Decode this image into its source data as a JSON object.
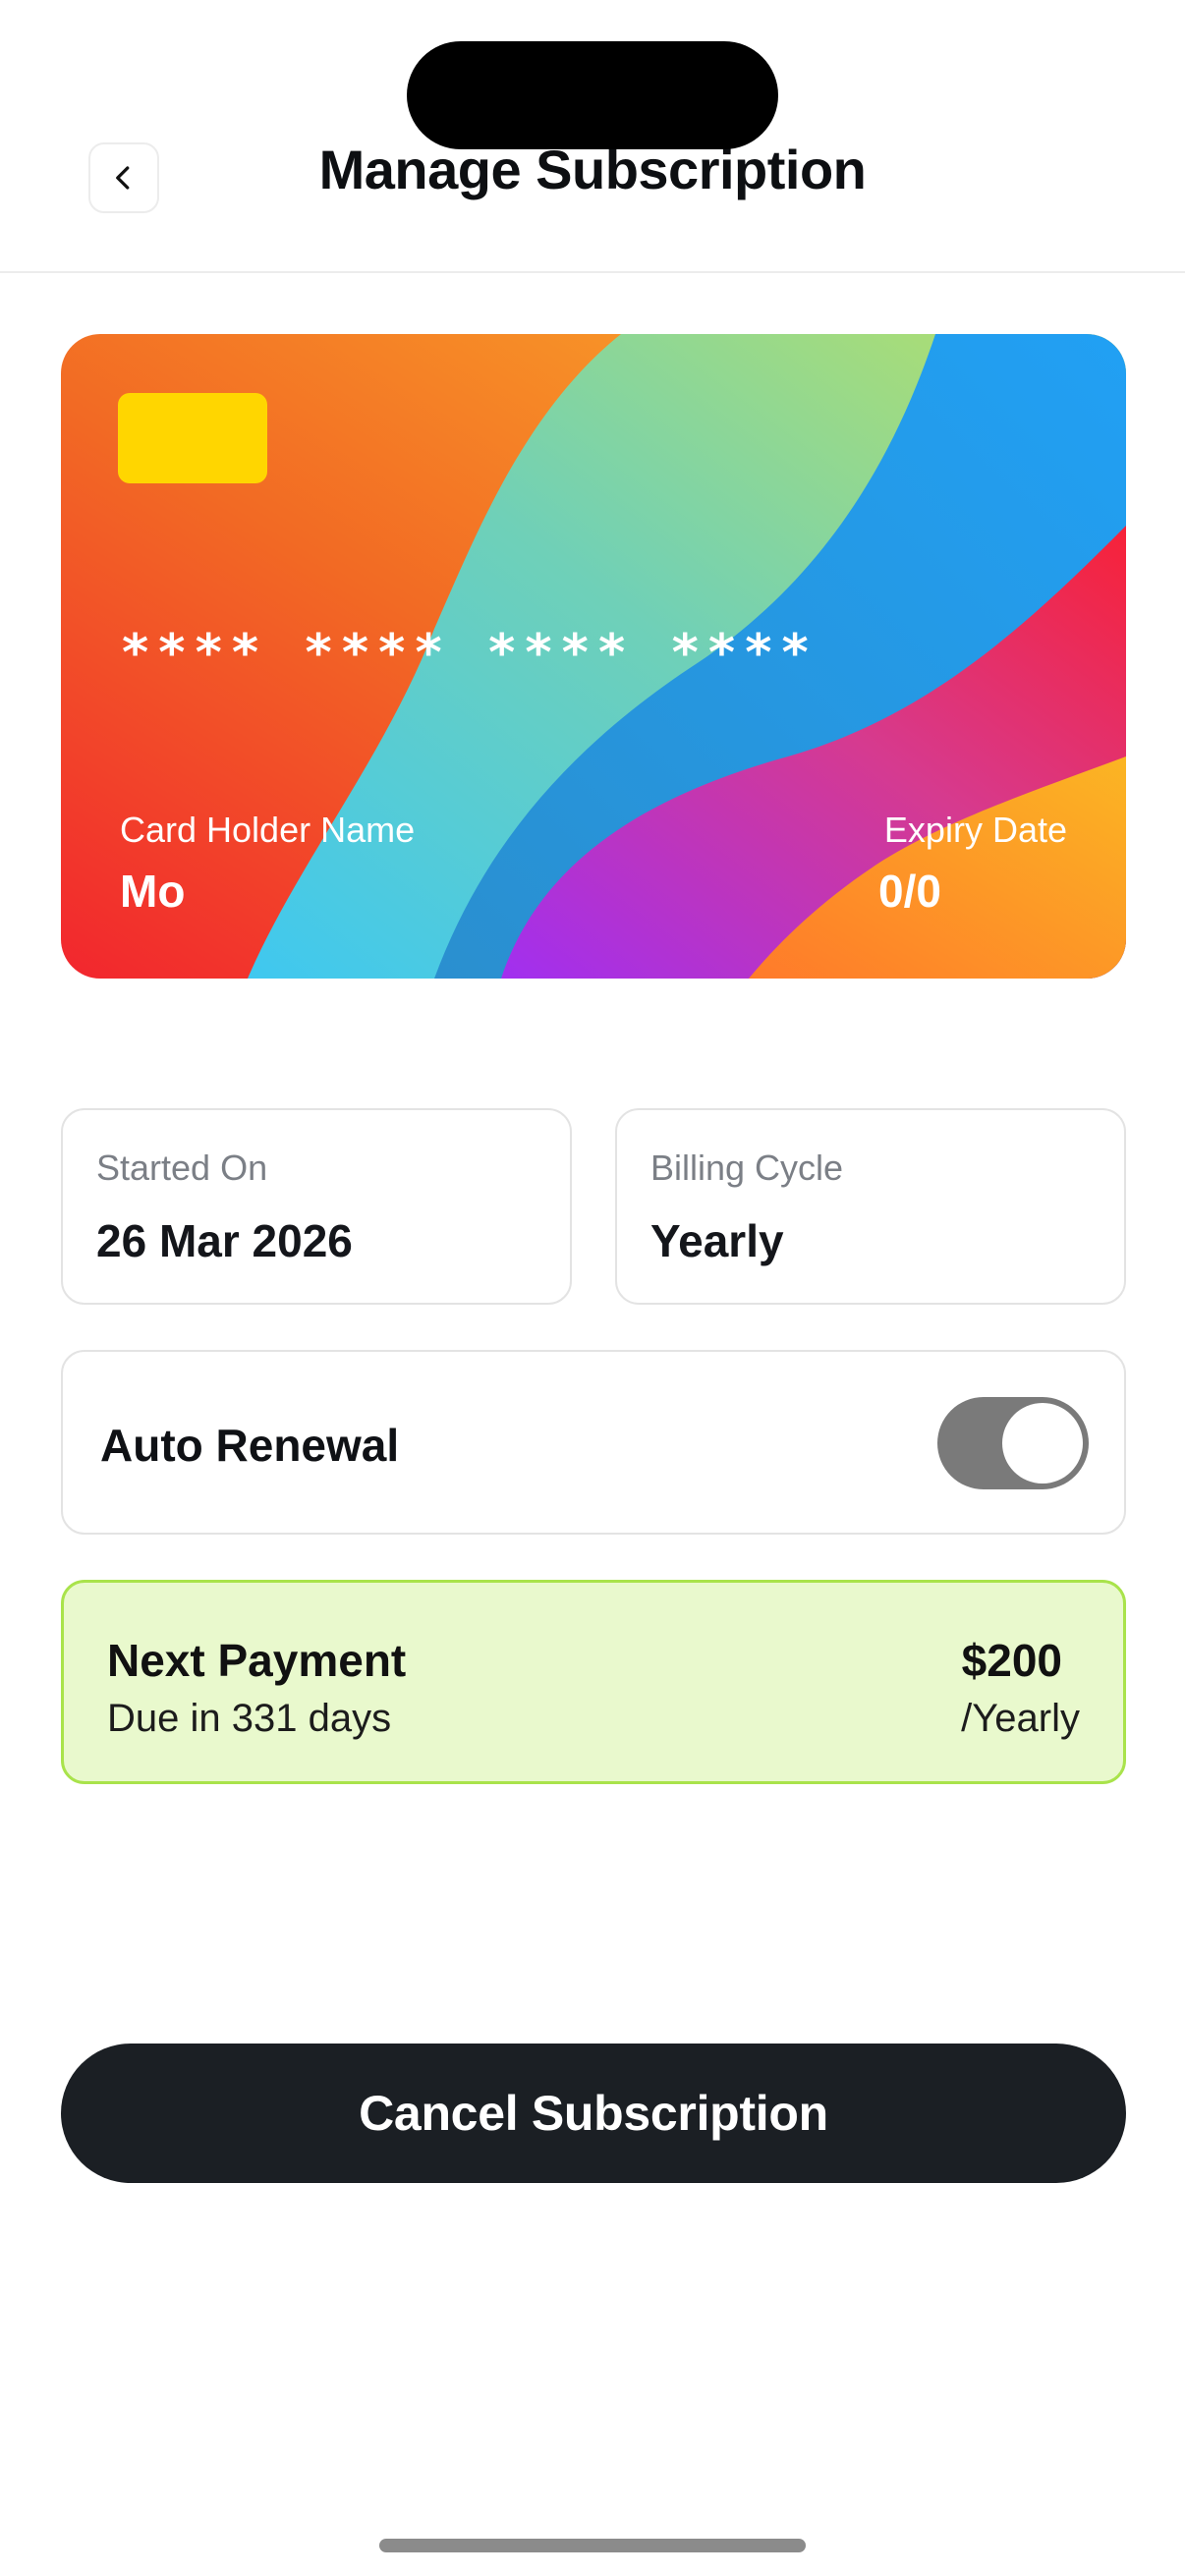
{
  "header": {
    "title": "Manage Subscription",
    "back_icon": "chevron-left-icon"
  },
  "card": {
    "number_masked": "**** **** **** ****",
    "holder_label": "Card Holder Name",
    "holder_value": "Mo",
    "expiry_label": "Expiry Date",
    "expiry_value": "0/0",
    "chip_color": "#FFD600"
  },
  "details": {
    "started_label": "Started On",
    "started_value": "26 Mar 2026",
    "billing_label": "Billing Cycle",
    "billing_value": "Yearly"
  },
  "auto_renewal": {
    "label": "Auto Renewal",
    "enabled": true
  },
  "next_payment": {
    "title": "Next Payment",
    "due_text": "Due in 331 days",
    "amount": "$200",
    "cycle": "/Yearly",
    "background_color": "#E9F9CD",
    "border_color": "#A9E34B"
  },
  "actions": {
    "cancel_label": "Cancel Subscription"
  }
}
